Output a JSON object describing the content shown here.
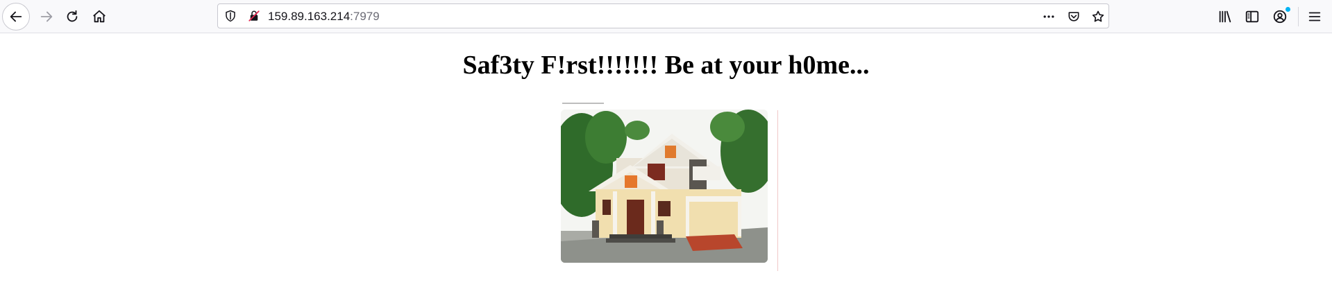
{
  "browser": {
    "url_host": "159.89.163.214",
    "url_port": ":7979",
    "icons": [
      "back-arrow-icon",
      "forward-arrow-icon",
      "reload-icon",
      "home-icon",
      "shield-icon",
      "insecure-lock-icon",
      "more-dots-icon",
      "pocket-icon",
      "star-icon",
      "library-icon",
      "sidebar-icon",
      "account-icon",
      "hamburger-menu-icon"
    ],
    "colors": {
      "toolbar_bg": "#f9f9fb",
      "notification_dot": "#00b3f4"
    }
  },
  "page": {
    "heading": "Saf3ty F!rst!!!!!!! Be at your h0me...",
    "image_subject": "house-photo"
  }
}
